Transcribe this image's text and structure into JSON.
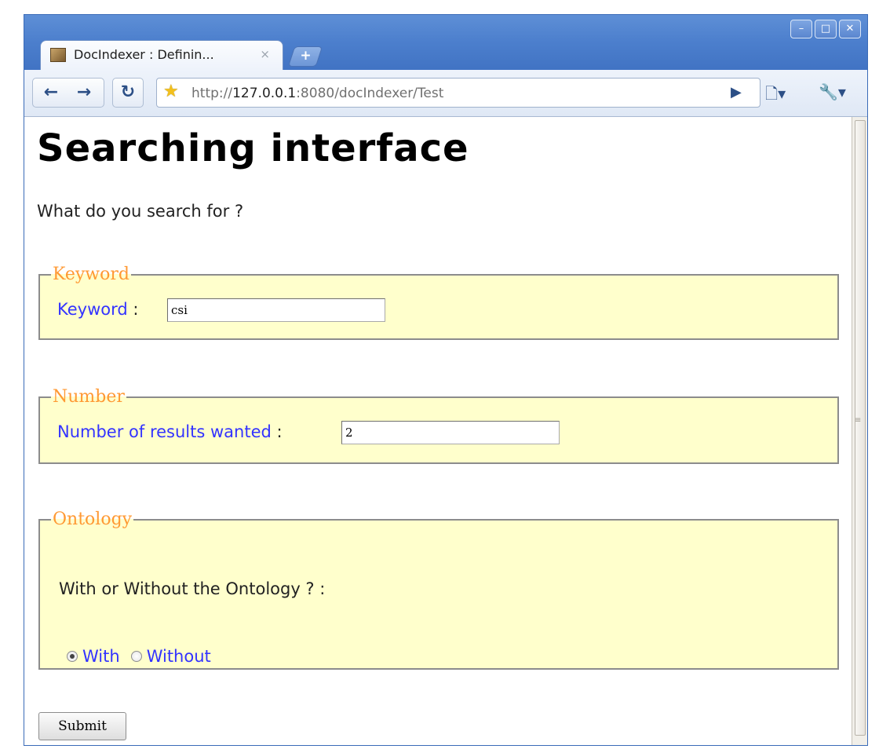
{
  "browser": {
    "tab_title": "DocIndexer : Definin...",
    "tab_close": "×",
    "new_tab": "+",
    "window_controls": {
      "minimize": "–",
      "maximize": "□",
      "close": "✕"
    },
    "url_prefix": "http://",
    "url_host": "127.0.0.1",
    "url_rest": ":8080/docIndexer/Test",
    "icons": {
      "back": "arrow-left-icon",
      "forward": "arrow-right-icon",
      "reload": "reload-icon",
      "bookmark": "star-icon",
      "go": "play-icon",
      "page_menu": "page-menu-icon",
      "settings": "wrench-icon"
    }
  },
  "page": {
    "heading": "Searching interface",
    "question": "What do you search for ?",
    "keyword_section": {
      "legend": "Keyword",
      "label": "Keyword",
      "separator": ":",
      "value": "csi"
    },
    "number_section": {
      "legend": "Number",
      "label": "Number of results wanted",
      "separator": ":",
      "value": "2"
    },
    "ontology_section": {
      "legend": "Ontology",
      "prompt": "With or Without the Ontology ? :",
      "options": [
        {
          "label": "With",
          "selected": true
        },
        {
          "label": "Without",
          "selected": false
        }
      ]
    },
    "submit_label": "Submit"
  },
  "colors": {
    "legend": "#ff9933",
    "label": "#3333ff",
    "fieldset_bg": "#ffffcc",
    "titlebar": "#4c7fcd"
  }
}
